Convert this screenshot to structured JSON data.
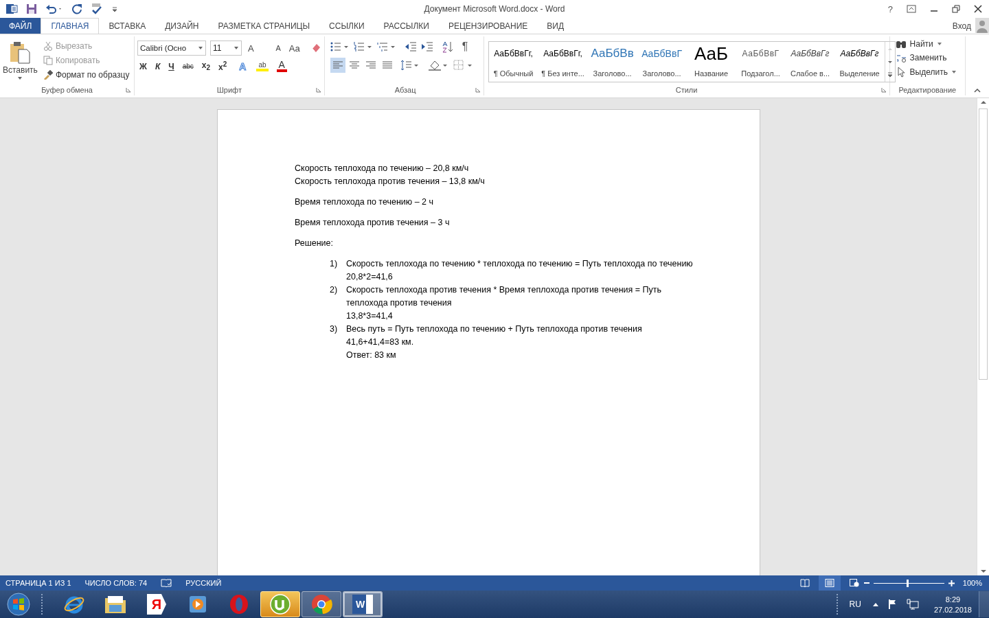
{
  "window": {
    "title": "Документ Microsoft Word.docx - Word",
    "help": "?"
  },
  "tabs": [
    {
      "label": "ФАЙЛ",
      "kind": "file",
      "selected": false
    },
    {
      "label": "ГЛАВНАЯ",
      "kind": "tab",
      "selected": true
    },
    {
      "label": "ВСТАВКА",
      "kind": "tab",
      "selected": false
    },
    {
      "label": "ДИЗАЙН",
      "kind": "tab",
      "selected": false
    },
    {
      "label": "РАЗМЕТКА СТРАНИЦЫ",
      "kind": "tab",
      "selected": false
    },
    {
      "label": "ССЫЛКИ",
      "kind": "tab",
      "selected": false
    },
    {
      "label": "РАССЫЛКИ",
      "kind": "tab",
      "selected": false
    },
    {
      "label": "РЕЦЕНЗИРОВАНИЕ",
      "kind": "tab",
      "selected": false
    },
    {
      "label": "ВИД",
      "kind": "tab",
      "selected": false
    }
  ],
  "sign_in": "Вход",
  "clipboard": {
    "paste": "Вставить",
    "items": [
      {
        "kind": "cut",
        "label": "Вырезать",
        "disabled": true
      },
      {
        "kind": "copy",
        "label": "Копировать",
        "disabled": true
      },
      {
        "kind": "painter",
        "label": "Формат по образцу",
        "disabled": false
      }
    ],
    "label": "Буфер обмена"
  },
  "font": {
    "name": "Calibri (Осно",
    "size": "11",
    "tools": [
      {
        "kind": "grow",
        "label": "A"
      },
      {
        "kind": "shrink",
        "label": "A"
      },
      {
        "kind": "case",
        "label": "Aa"
      }
    ],
    "formats": [
      {
        "kind": "bold",
        "label": "Ж"
      },
      {
        "kind": "italic",
        "label": "К"
      },
      {
        "kind": "underline",
        "label": "Ч"
      },
      {
        "kind": "strike",
        "label": "abc"
      },
      {
        "kind": "sub",
        "label": "x$_{2}$"
      },
      {
        "kind": "sup",
        "label": "x$^{2}$"
      }
    ],
    "effects": [
      {
        "kind": "effects",
        "label": "A"
      },
      {
        "kind": "highlight",
        "label": "ab"
      },
      {
        "kind": "color",
        "label": "A"
      }
    ],
    "label": "Шрифт"
  },
  "paragraph": {
    "pilcrow": "¶",
    "alignments": [
      {
        "kind": "left",
        "selected": true
      },
      {
        "kind": "center",
        "selected": false
      },
      {
        "kind": "right",
        "selected": false
      },
      {
        "kind": "justify",
        "selected": false
      }
    ],
    "label": "Абзац"
  },
  "styles": {
    "items": [
      {
        "preview": "АаБбВвГг,",
        "name": "¶ Обычный",
        "kind": "normal"
      },
      {
        "preview": "АаБбВвГг,",
        "name": "¶ Без инте...",
        "kind": "normal"
      },
      {
        "preview": "АаБбВв",
        "name": "Заголово...",
        "kind": "heading1"
      },
      {
        "preview": "АаБбВвГ",
        "name": "Заголово...",
        "kind": "heading2"
      },
      {
        "preview": "АаБ",
        "name": "Название",
        "kind": "title"
      },
      {
        "preview": "АаБбВвГ",
        "name": "Подзагол...",
        "kind": "subtitle"
      },
      {
        "preview": "АаБбВвГг",
        "name": "Слабое в...",
        "kind": "subtle"
      },
      {
        "preview": "АаБбВвГг",
        "name": "Выделение",
        "kind": "emphasis"
      }
    ],
    "label": "Стили"
  },
  "editing": {
    "items": [
      {
        "kind": "find",
        "label": "Найти"
      },
      {
        "kind": "replace",
        "label": "Заменить"
      },
      {
        "kind": "select",
        "label": "Выделить"
      }
    ],
    "label": "Редактирование"
  },
  "document": {
    "paragraphs": [
      {
        "lines": [
          "Скорость теплохода по течению – 20,8 км/ч",
          "Скорость теплохода против течения – 13,8 км/ч"
        ]
      },
      {
        "lines": [
          "Время теплохода по течению – 2 ч"
        ]
      },
      {
        "lines": [
          "Время теплохода против течения – 3 ч"
        ]
      },
      {
        "lines": [
          "Решение:"
        ]
      }
    ],
    "list": [
      {
        "number": "1)",
        "lines": [
          "Скорость теплохода по течению * теплохода по течению = Путь теплохода по течению",
          "20,8*2=41,6"
        ]
      },
      {
        "number": "2)",
        "lines": [
          "Скорость теплохода против течения * Время теплохода против течения = Путь",
          "теплохода против течения",
          "13,8*3=41,4"
        ]
      },
      {
        "number": "3)",
        "lines": [
          "Весь путь = Путь теплохода по течению + Путь теплохода против течения",
          "41,6+41,4=83 км.",
          "Ответ: 83 км"
        ]
      }
    ]
  },
  "status_bar": {
    "page": "СТРАНИЦА 1 ИЗ 1",
    "words": "ЧИСЛО СЛОВ: 74",
    "language": "РУССКИЙ",
    "views": [
      {
        "kind": "read",
        "selected": false
      },
      {
        "kind": "print",
        "selected": true
      },
      {
        "kind": "web",
        "selected": false
      }
    ],
    "zoom": {
      "level": 0.48,
      "reading": "100%"
    }
  },
  "taskbar": {
    "apps": [
      {
        "kind": "ie",
        "running": false,
        "attention": false,
        "selected": false
      },
      {
        "kind": "explorer",
        "running": false,
        "attention": false,
        "selected": false
      },
      {
        "kind": "yandex",
        "running": false,
        "attention": false,
        "selected": false,
        "label": "Я"
      },
      {
        "kind": "media",
        "running": false,
        "attention": false,
        "selected": false
      },
      {
        "kind": "opera",
        "running": false,
        "attention": false,
        "selected": false
      },
      {
        "kind": "utorrent",
        "running": true,
        "attention": true,
        "selected": false
      },
      {
        "kind": "chrome",
        "running": true,
        "attention": false,
        "selected": false
      },
      {
        "kind": "word",
        "running": true,
        "attention": false,
        "selected": true,
        "label": "W"
      }
    ],
    "language": "RU",
    "time": "8:29",
    "date": "27.02.2018"
  }
}
